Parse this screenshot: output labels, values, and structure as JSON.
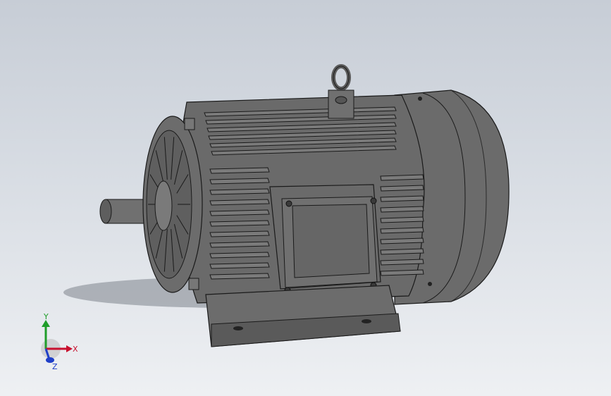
{
  "viewport": {
    "background_top": "#c7cdd6",
    "background_bottom": "#eef0f3"
  },
  "model": {
    "name": "electric-motor",
    "body_color": "#6e6e6e",
    "edge_color": "#1a1a1a"
  },
  "triad": {
    "x_label": "X",
    "y_label": "Y",
    "z_label": "Z",
    "x_color": "#c8102e",
    "y_color": "#1f9d2a",
    "z_color": "#1f3fc8"
  }
}
